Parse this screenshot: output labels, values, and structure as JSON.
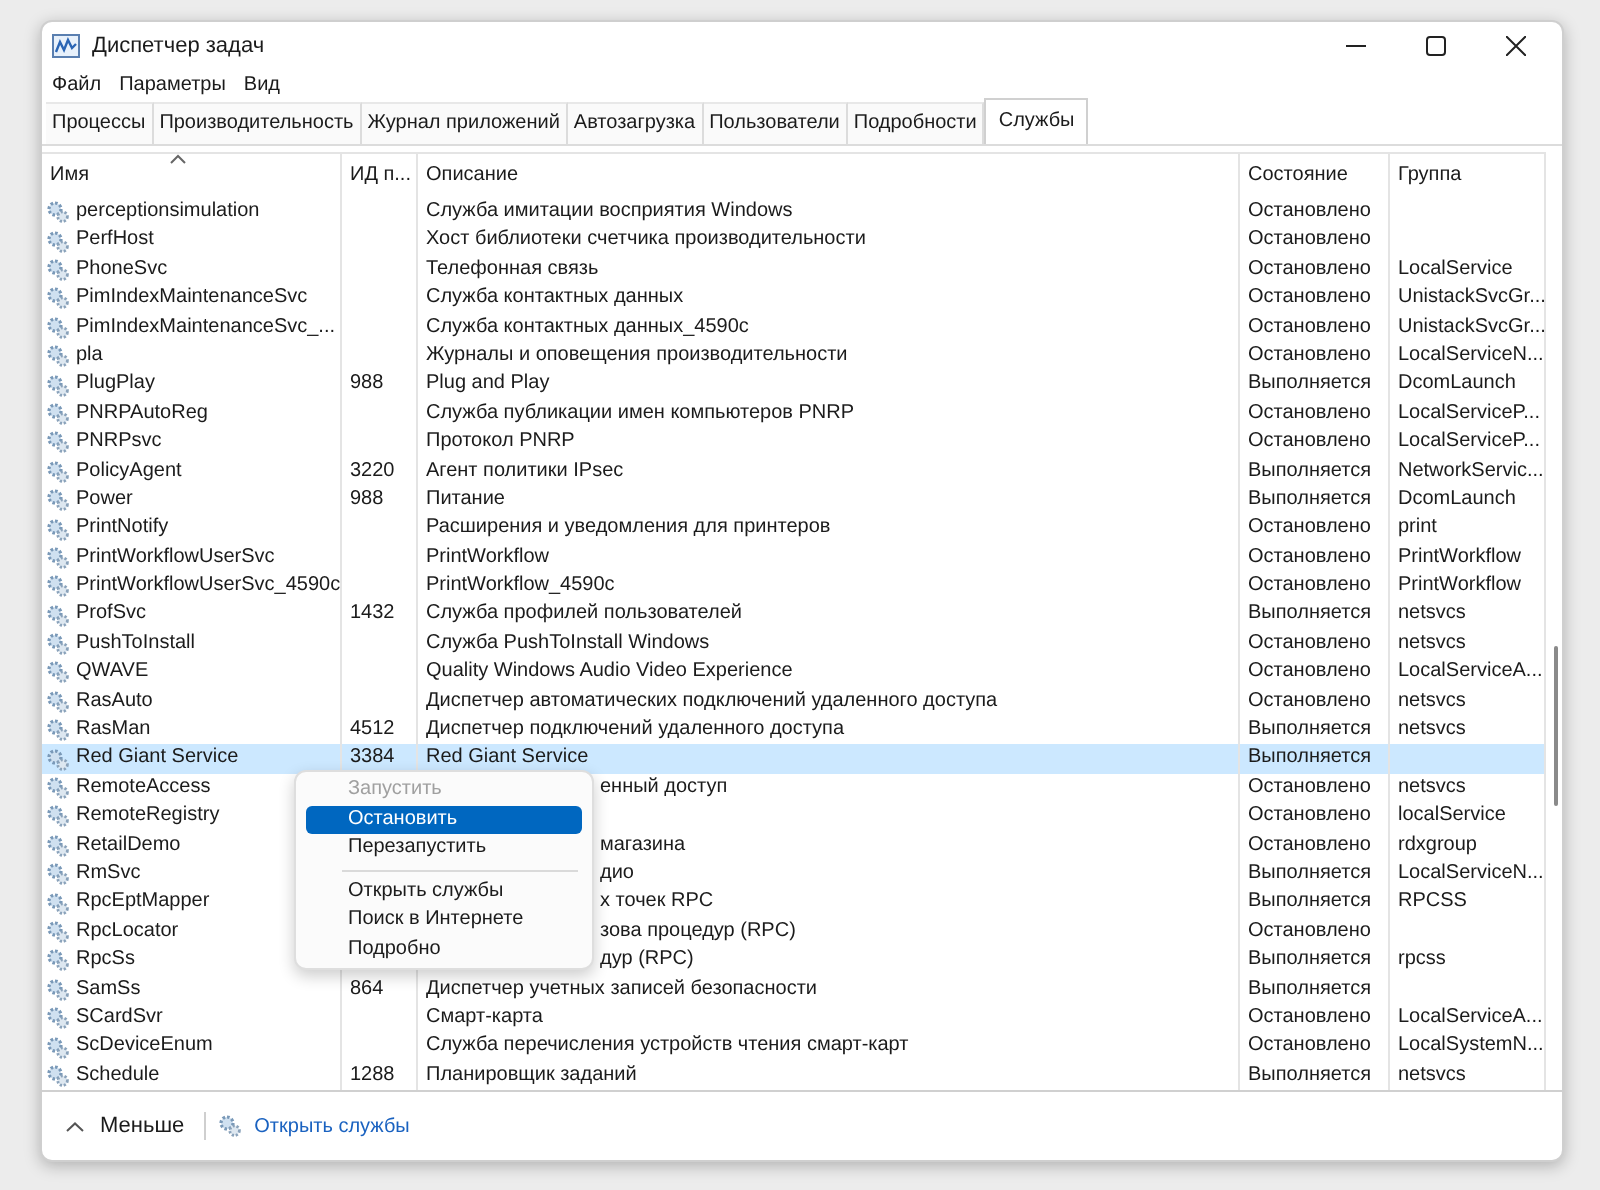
{
  "window": {
    "title": "Диспетчер задач"
  },
  "menu": [
    "Файл",
    "Параметры",
    "Вид"
  ],
  "tabs": [
    {
      "label": "Процессы",
      "selected": false
    },
    {
      "label": "Производительность",
      "selected": false
    },
    {
      "label": "Журнал приложений",
      "selected": false
    },
    {
      "label": "Автозагрузка",
      "selected": false
    },
    {
      "label": "Пользователи",
      "selected": false
    },
    {
      "label": "Подробности",
      "selected": false
    },
    {
      "label": "Службы",
      "selected": true
    }
  ],
  "table": {
    "columns": [
      "Имя",
      "ИД п...",
      "Описание",
      "Состояние",
      "Группа"
    ],
    "rows": [
      {
        "kind": "full",
        "name": "perceptionsimulation",
        "pid": "",
        "description": "Служба имитации восприятия Windows",
        "status": "Остановлено",
        "group": "",
        "selected": false
      },
      {
        "kind": "full",
        "name": "PerfHost",
        "pid": "",
        "description": "Хост библиотеки счетчика производительности",
        "status": "Остановлено",
        "group": "",
        "selected": false
      },
      {
        "kind": "full",
        "name": "PhoneSvc",
        "pid": "",
        "description": "Телефонная связь",
        "status": "Остановлено",
        "group": "LocalService",
        "selected": false
      },
      {
        "kind": "full",
        "name": "PimIndexMaintenanceSvc",
        "pid": "",
        "description": "Служба контактных данных",
        "status": "Остановлено",
        "group": "UnistackSvcGr...",
        "selected": false
      },
      {
        "kind": "full",
        "name": "PimIndexMaintenanceSvc_...",
        "pid": "",
        "description": "Служба контактных данных_4590c",
        "status": "Остановлено",
        "group": "UnistackSvcGr...",
        "selected": false
      },
      {
        "kind": "full",
        "name": "pla",
        "pid": "",
        "description": "Журналы и оповещения производительности",
        "status": "Остановлено",
        "group": "LocalServiceN...",
        "selected": false
      },
      {
        "kind": "full",
        "name": "PlugPlay",
        "pid": "988",
        "description": "Plug and Play",
        "status": "Выполняется",
        "group": "DcomLaunch",
        "selected": false
      },
      {
        "kind": "full",
        "name": "PNRPAutoReg",
        "pid": "",
        "description": "Служба публикации имен компьютеров PNRP",
        "status": "Остановлено",
        "group": "LocalServiceP...",
        "selected": false
      },
      {
        "kind": "full",
        "name": "PNRPsvc",
        "pid": "",
        "description": "Протокол PNRP",
        "status": "Остановлено",
        "group": "LocalServiceP...",
        "selected": false
      },
      {
        "kind": "full",
        "name": "PolicyAgent",
        "pid": "3220",
        "description": "Агент политики IPsec",
        "status": "Выполняется",
        "group": "NetworkServic...",
        "selected": false
      },
      {
        "kind": "full",
        "name": "Power",
        "pid": "988",
        "description": "Питание",
        "status": "Выполняется",
        "group": "DcomLaunch",
        "selected": false
      },
      {
        "kind": "full",
        "name": "PrintNotify",
        "pid": "",
        "description": "Расширения и уведомления для принтеров",
        "status": "Остановлено",
        "group": "print",
        "selected": false
      },
      {
        "kind": "full",
        "name": "PrintWorkflowUserSvc",
        "pid": "",
        "description": "PrintWorkflow",
        "status": "Остановлено",
        "group": "PrintWorkflow",
        "selected": false
      },
      {
        "kind": "full",
        "name": "PrintWorkflowUserSvc_4590c",
        "pid": "",
        "description": "PrintWorkflow_4590c",
        "status": "Остановлено",
        "group": "PrintWorkflow",
        "selected": false
      },
      {
        "kind": "full",
        "name": "ProfSvc",
        "pid": "1432",
        "description": "Служба профилей пользователей",
        "status": "Выполняется",
        "group": "netsvcs",
        "selected": false
      },
      {
        "kind": "full",
        "name": "PushToInstall",
        "pid": "",
        "description": "Служба PushToInstall Windows",
        "status": "Остановлено",
        "group": "netsvcs",
        "selected": false
      },
      {
        "kind": "full",
        "name": "QWAVE",
        "pid": "",
        "description": "Quality Windows Audio Video Experience",
        "status": "Остановлено",
        "group": "LocalServiceA...",
        "selected": false
      },
      {
        "kind": "full",
        "name": "RasAuto",
        "pid": "",
        "description": "Диспетчер автоматических подключений удаленного доступа",
        "status": "Остановлено",
        "group": "netsvcs",
        "selected": false
      },
      {
        "kind": "full",
        "name": "RasMan",
        "pid": "4512",
        "description": "Диспетчер подключений удаленного доступа",
        "status": "Выполняется",
        "group": "netsvcs",
        "selected": false
      },
      {
        "kind": "full",
        "name": "Red Giant Service",
        "pid": "3384",
        "description": "Red Giant Service",
        "status": "Выполняется",
        "group": "",
        "selected": true
      },
      {
        "kind": "covered",
        "name": "RemoteAccess",
        "description": "енный доступ",
        "status": "Остановлено",
        "group": "netsvcs",
        "selected": false
      },
      {
        "kind": "covered",
        "name": "RemoteRegistry",
        "status": "Остановлено",
        "group": "localService",
        "selected": false
      },
      {
        "kind": "covered",
        "name": "RetailDemo",
        "description": "магазина",
        "status": "Остановлено",
        "group": "rdxgroup",
        "selected": false
      },
      {
        "kind": "covered",
        "name": "RmSvc",
        "description": "дио",
        "status": "Выполняется",
        "group": "LocalServiceN...",
        "selected": false
      },
      {
        "kind": "covered",
        "name": "RpcEptMapper",
        "description": "х точек RPC",
        "status": "Выполняется",
        "group": "RPCSS",
        "selected": false
      },
      {
        "kind": "covered",
        "name": "RpcLocator",
        "description": "зова процедур (RPC)",
        "status": "Остановлено",
        "group": "",
        "selected": false
      },
      {
        "kind": "covered",
        "name": "RpcSs",
        "description": "дур (RPC)",
        "status": "Выполняется",
        "group": "rpcss",
        "selected": false
      },
      {
        "kind": "full",
        "name": "SamSs",
        "pid": "864",
        "description": "Диспетчер учетных записей безопасности",
        "status": "Выполняется",
        "group": "",
        "selected": false
      },
      {
        "kind": "full",
        "name": "SCardSvr",
        "pid": "",
        "description": "Смарт-карта",
        "status": "Остановлено",
        "group": "LocalServiceA...",
        "selected": false
      },
      {
        "kind": "full",
        "name": "ScDeviceEnum",
        "pid": "",
        "description": "Служба перечисления устройств чтения смарт-карт",
        "status": "Остановлено",
        "group": "LocalSystemN...",
        "selected": false
      },
      {
        "kind": "full",
        "name": "Schedule",
        "pid": "1288",
        "description": "Планировщик заданий",
        "status": "Выполняется",
        "group": "netsvcs",
        "selected": false
      }
    ]
  },
  "context_menu": [
    {
      "kind": "item",
      "label": "Запустить",
      "disabled": true,
      "selected": false
    },
    {
      "kind": "item",
      "label": "Остановить",
      "disabled": false,
      "selected": true
    },
    {
      "kind": "item",
      "label": "Перезапустить",
      "disabled": false,
      "selected": false
    },
    {
      "kind": "separator"
    },
    {
      "kind": "item",
      "label": "Открыть службы",
      "disabled": false,
      "selected": false
    },
    {
      "kind": "item",
      "label": "Поиск в Интернете",
      "disabled": false,
      "selected": false
    },
    {
      "kind": "item",
      "label": "Подробно",
      "disabled": false,
      "selected": false
    }
  ],
  "footer": {
    "less_button": "Меньше",
    "open_services_link": "Открыть службы"
  }
}
